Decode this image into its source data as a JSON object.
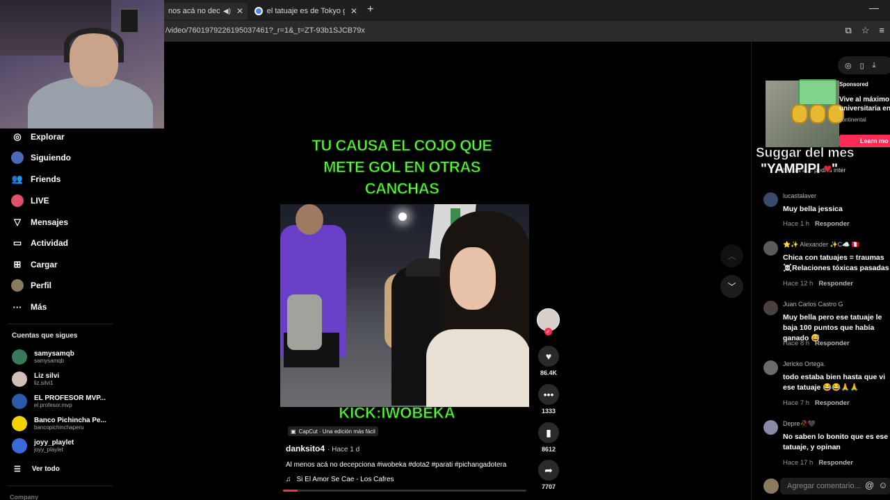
{
  "browser": {
    "tabs": [
      {
        "label": "nos acá no decepcion",
        "active": true
      },
      {
        "label": "el tatuaje es de Tokyo ghoul ar",
        "active": false
      }
    ],
    "url": "/video/7601979226195037461?_r=1&_t=ZT-93b1SJCB79x"
  },
  "sidebar": {
    "nav": [
      {
        "label": "Explorar",
        "icon": "compass-icon"
      },
      {
        "label": "Siguiendo",
        "icon": "following-icon"
      },
      {
        "label": "Friends",
        "icon": "friends-icon"
      },
      {
        "label": "LIVE",
        "icon": "live-icon"
      },
      {
        "label": "Mensajes",
        "icon": "messages-icon"
      },
      {
        "label": "Actividad",
        "icon": "activity-icon"
      },
      {
        "label": "Cargar",
        "icon": "upload-icon"
      },
      {
        "label": "Perfil",
        "icon": "profile-icon"
      },
      {
        "label": "Más",
        "icon": "more-icon"
      }
    ],
    "following_title": "Cuentas que sigues",
    "following": [
      {
        "name": "samysamqb",
        "handle": "samysamqb",
        "color": "#3a7a5a"
      },
      {
        "name": "Liz silvi",
        "handle": "liz.silvi1",
        "color": "#d0c0b8"
      },
      {
        "name": "EL PROFESOR MVP...",
        "handle": "el.profesor.mvp",
        "color": "#2a5aa8"
      },
      {
        "name": "Banco Pichincha Pe...",
        "handle": "bancopichinchaperu",
        "color": "#f2d200"
      },
      {
        "name": "joyy_playlet",
        "handle": "joyy_playlet",
        "color": "#3a6ad8"
      }
    ],
    "see_all": "Ver todo",
    "company": "Company"
  },
  "video": {
    "caption_top": "TU CAUSA EL COJO QUE METE GOL EN OTRAS CANCHAS",
    "caption_bottom": "KICK:IWOBEKA",
    "capcut": "CapCut · Una edición más fácil",
    "author": "danksito4",
    "time": "· Hace 1 d",
    "description": "Al menos acá no decepciona #iwobeka #dota2 #parati #pichangadotera",
    "music": "Si El Amor Se Cae - Los Cafres",
    "progress": 0.06
  },
  "actions": {
    "likes": "86.4K",
    "comments": "1333",
    "saves": "8612",
    "shares": "7707"
  },
  "ad": {
    "sponsored": "Sponsored",
    "title": "Vive al máximo universitaria en",
    "brand": "continental",
    "cta": "Learn mo"
  },
  "overlay": {
    "line1": "Suggar del mes",
    "line2": "\"YAMPIPI",
    "small": "Ahí otra la... podría inter"
  },
  "comments": [
    {
      "user": "lucastalaver",
      "text": "Muy bella jessica",
      "time": "Hace 1 h",
      "reply": "Responder",
      "color": "#3a4a6a"
    },
    {
      "user": "⭐✨ Alexander ✨C☁️ 🇵🇪",
      "text": "Chica con tatuajes = traumas ☠️Relaciones tóxicas pasadas",
      "time": "Hace 12 h",
      "reply": "Responder",
      "color": "#5a5a5a"
    },
    {
      "user": "Juan Carlos Castro G",
      "text": "Muy bella pero ese tatuaje le baja 100 puntos que había ganado 😅",
      "time": "Hace 8 h",
      "reply": "Responder",
      "color": "#4a4040"
    },
    {
      "user": "Jericko Ortega.",
      "text": "todo estaba bien hasta que vi ese tatuaje 😂😂🙏🙏",
      "time": "Hace 7 h",
      "reply": "Responder",
      "color": "#6a6a6a"
    },
    {
      "user": "Depre🥀🖤",
      "text": "No saben lo bonito que es ese tatuaje, y opinan",
      "time": "Hace 17 h",
      "reply": "Responder",
      "color": "#8a8aa8"
    }
  ],
  "comment_input": {
    "placeholder": "Agregar comentario..."
  }
}
